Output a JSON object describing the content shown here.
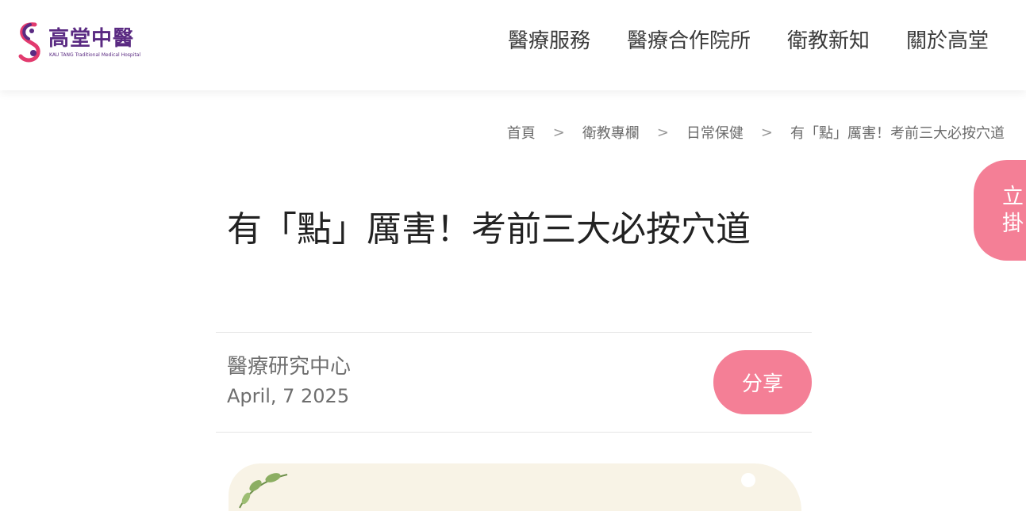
{
  "brand": {
    "name": "高堂中醫",
    "subtitle": "KAU TANG Traditional Medical Hospital",
    "colors": {
      "primary": "#5a2a82",
      "accent": "#e23a6e"
    }
  },
  "nav": {
    "items": [
      {
        "label": "醫療服務"
      },
      {
        "label": "醫療合作院所"
      },
      {
        "label": "衛教新知"
      },
      {
        "label": "關於高堂"
      }
    ]
  },
  "breadcrumb": {
    "items": [
      "首頁",
      "衛教專欄",
      "日常保健"
    ],
    "current": "有「點」厲害！考前三大必按穴道",
    "separator": ">"
  },
  "side_cta": {
    "label": "立即掛號",
    "visible_text": "立掛",
    "color": "#f47f96"
  },
  "article": {
    "title": "有「點」厲害！考前三大必按穴道",
    "author": "醫療研究中心",
    "date": "April, 7 2025",
    "share_label": "分享"
  }
}
